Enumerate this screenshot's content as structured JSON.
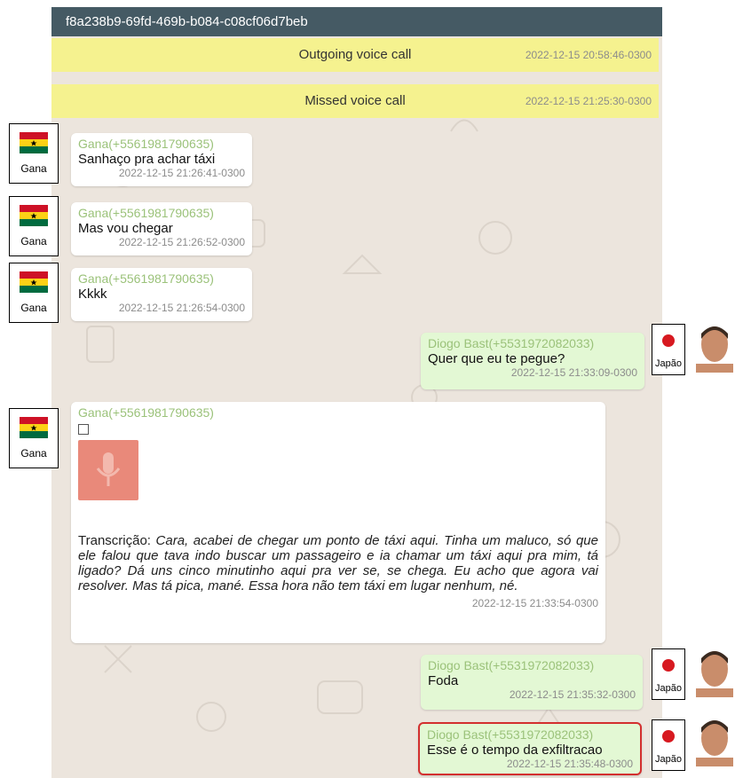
{
  "header": {
    "title": "f8a238b9-69fd-469b-b084-c08cf06d7beb"
  },
  "system_messages": [
    {
      "text": "Outgoing voice call",
      "timestamp": "2022-12-15 20:58:46-0300"
    },
    {
      "text": "Missed voice call",
      "timestamp": "2022-12-15 21:25:30-0300"
    }
  ],
  "contacts": {
    "gana": {
      "label": "Gana",
      "flag_icon": "ghana-flag-icon",
      "sender": "Gana(+5561981790635)"
    },
    "diogo": {
      "label": "Japão",
      "flag_icon": "japan-flag-icon",
      "sender": "Diogo Bast(+5531972082033)"
    }
  },
  "messages": [
    {
      "from": "gana",
      "text": "Sanhaço pra achar táxi",
      "timestamp": "2022-12-15 21:26:41-0300"
    },
    {
      "from": "gana",
      "text": "Mas vou chegar",
      "timestamp": "2022-12-15 21:26:52-0300"
    },
    {
      "from": "gana",
      "text": "Kkkk",
      "timestamp": "2022-12-15 21:26:54-0300"
    },
    {
      "from": "diogo",
      "text": "Quer que eu te pegue?",
      "timestamp": "2022-12-15 21:33:09-0300"
    },
    {
      "from": "gana",
      "type": "audio",
      "transcript_label": "Transcrição:",
      "transcript": "Cara, acabei de chegar um ponto de táxi aqui. Tinha um maluco, só que ele falou que tava indo buscar um passageiro e ia chamar um táxi aqui pra mim, tá ligado? Dá uns cinco minutinho aqui pra ver se, se chega. Eu acho que agora vai resolver. Mas tá pica, mané. Essa hora não tem táxi em lugar nenhum, né.",
      "timestamp": "2022-12-15 21:33:54-0300"
    },
    {
      "from": "diogo",
      "text": "Foda",
      "timestamp": "2022-12-15 21:35:32-0300"
    },
    {
      "from": "diogo",
      "text": "Esse é o tempo da exfiltracao",
      "timestamp": "2022-12-15 21:35:48-0300",
      "selected": true
    }
  ],
  "colors": {
    "header": "#455a64",
    "system_message": "#f5f28f",
    "outgoing_bubble": "#e3f8d4",
    "incoming_bubble": "#ffffff",
    "sender_name": "#9bc27a",
    "selection_border": "#d32f2f"
  }
}
